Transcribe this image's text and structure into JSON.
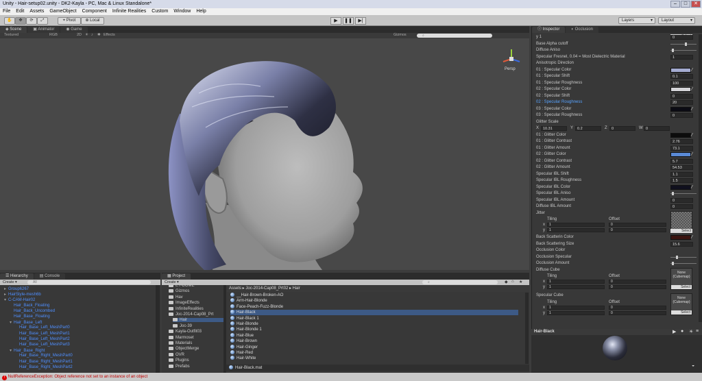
{
  "window": {
    "title": "Unity - Hair-setup02.unity - DK2-Kayla - PC, Mac & Linux Standalone*"
  },
  "menu": [
    "File",
    "Edit",
    "Assets",
    "GameObject",
    "Component",
    "Infinite Realities",
    "Custom",
    "Window",
    "Help"
  ],
  "toolbar": {
    "pivot": "Pivot",
    "local": "Local",
    "layers": "Layers",
    "layout": "Layout",
    "play_icon": "play-icon",
    "pause_icon": "pause-icon",
    "step_icon": "step-icon"
  },
  "scene": {
    "tabs": [
      "Scene",
      "Animator",
      "Game"
    ],
    "textured": "Textured",
    "rgb": "RGB",
    "mode2d": "2D",
    "effects": "Effects",
    "gizmos": "Gizmos",
    "persp": "Persp"
  },
  "inspector": {
    "tabs": [
      "Inspector",
      "Occlusion"
    ],
    "select": "Select",
    "rows": [
      {
        "label": "y 1",
        "value": "0",
        "kind": "tile"
      },
      {
        "label": "Base Alpha cutoff",
        "kind": "slider",
        "pos": 0.55
      },
      {
        "label": "Diffuse Aniso",
        "kind": "slider",
        "pos": 0.05
      },
      {
        "label": "Specular Fresnel, 0.04 = Most Dielectric Material",
        "value": "1",
        "kind": "value"
      },
      {
        "label": "Anisotropic Direction",
        "kind": "none"
      },
      {
        "label": "01 : Specular Color",
        "kind": "color",
        "color": "#a4abd0"
      },
      {
        "label": "01 : Specular Shift",
        "value": "0.1",
        "kind": "value"
      },
      {
        "label": "01 : Specular Roughness",
        "value": "100",
        "kind": "value"
      },
      {
        "label": "02 : Specular Color",
        "kind": "color",
        "color": "#d4d4d8"
      },
      {
        "label": "02 : Specular Shift",
        "value": "0",
        "kind": "value"
      },
      {
        "label": "02 : Specular Roughness",
        "value": "20",
        "kind": "value",
        "highlight": true
      },
      {
        "label": "03 : Specular Color",
        "kind": "color",
        "color": "#0b0b14"
      },
      {
        "label": "03 : Specular Roughness",
        "value": "0",
        "kind": "value"
      },
      {
        "label": "Glitter Scale",
        "kind": "none"
      },
      {
        "label": "glitter_vector",
        "kind": "vector"
      },
      {
        "label": "01 : Glitter Color",
        "kind": "color",
        "color": "#0c0c0c"
      },
      {
        "label": "01 : Glitter Contrast",
        "value": "2.76",
        "kind": "value"
      },
      {
        "label": "01 : Glitter Amount",
        "value": "73.1",
        "kind": "value"
      },
      {
        "label": "02 : Glitter Color",
        "kind": "color",
        "color": "#5a8ad6"
      },
      {
        "label": "02 : Glitter Contrast",
        "value": "5.7",
        "kind": "value"
      },
      {
        "label": "02 : Glitter Amount",
        "value": "54.53",
        "kind": "value"
      },
      {
        "label": "Specular IBL Shift",
        "value": "1.1",
        "kind": "value"
      },
      {
        "label": "Specular IBL Roughness",
        "value": "1.5",
        "kind": "value"
      },
      {
        "label": "Specular IBL Color",
        "kind": "color",
        "color": "#10101e"
      },
      {
        "label": "Specular IBL Aniso",
        "kind": "slider",
        "pos": 0.05
      },
      {
        "label": "Specular IBL Amount",
        "value": "0",
        "kind": "value"
      },
      {
        "label": "Diffuse IBL Amount",
        "value": "0",
        "kind": "value"
      }
    ],
    "vector": {
      "x_label": "X",
      "x": "10.31",
      "y_label": "Y",
      "y": "0.2",
      "z_label": "Z",
      "z": "0",
      "w_label": "W",
      "w": "0"
    },
    "jitter": {
      "label": "Jitter",
      "tiling": "Tiling",
      "offset": "Offset",
      "x_label": "x",
      "x1": "1",
      "x2": "0",
      "y_label": "y",
      "y1": "1",
      "y2": "0"
    },
    "rows2": [
      {
        "label": "Back Scatterin Color",
        "kind": "color",
        "color": "#3a1410"
      },
      {
        "label": "Back Scattering Size",
        "value": "15.6",
        "kind": "value"
      },
      {
        "label": "Occlusion Color",
        "kind": "none"
      },
      {
        "label": "Occlusion Specular",
        "kind": "slider",
        "pos": 0.2
      },
      {
        "label": "Occlusion Amount",
        "kind": "slider",
        "pos": 0.05
      }
    ],
    "diffuse_cube": {
      "label": "Diffuse Cube",
      "tiling": "Tiling",
      "offset": "Offset",
      "x_label": "x",
      "x1": "1",
      "x2": "0",
      "y_label": "y",
      "y1": "1",
      "y2": "0",
      "none": "None",
      "cubemap": "(Cubemap)"
    },
    "specular_cube": {
      "label": "Specular Cube",
      "tiling": "Tiling",
      "offset": "Offset",
      "x_label": "x",
      "x1": "1",
      "x2": "0",
      "y_label": "y",
      "y1": "1",
      "y2": "0",
      "none": "None",
      "cubemap": "(Cubemap)"
    },
    "preview_title": "Hair-Black"
  },
  "hierarchy": {
    "tabs": [
      "Hierarchy",
      "Console"
    ],
    "create": "Create",
    "search": "All",
    "items": [
      {
        "label": "Group6267",
        "indent": 0,
        "arrow": "▸"
      },
      {
        "label": "HairStyle-mesh6b",
        "indent": 0,
        "arrow": "▸"
      },
      {
        "label": "C-CAM-Hair02",
        "indent": 0,
        "arrow": "▾"
      },
      {
        "label": "Hair_Back_Floating",
        "indent": 1,
        "arrow": ""
      },
      {
        "label": "Hair_Back_Uncombed",
        "indent": 1,
        "arrow": ""
      },
      {
        "label": "Hair_Base_Floating",
        "indent": 1,
        "arrow": ""
      },
      {
        "label": "Hair_Base_Left",
        "indent": 1,
        "arrow": "▾"
      },
      {
        "label": "Hair_Base_Left_MeshPart0",
        "indent": 2,
        "arrow": ""
      },
      {
        "label": "Hair_Base_Left_MeshPart1",
        "indent": 2,
        "arrow": ""
      },
      {
        "label": "Hair_Base_Left_MeshPart2",
        "indent": 2,
        "arrow": ""
      },
      {
        "label": "Hair_Base_Left_MeshPart3",
        "indent": 2,
        "arrow": ""
      },
      {
        "label": "Hair_Base_Right",
        "indent": 1,
        "arrow": "▾"
      },
      {
        "label": "Hair_Base_Right_MeshPart0",
        "indent": 2,
        "arrow": ""
      },
      {
        "label": "Hair_Base_Right_MeshPart1",
        "indent": 2,
        "arrow": ""
      },
      {
        "label": "Hair_Base_Right_MeshPart2",
        "indent": 2,
        "arrow": ""
      }
    ]
  },
  "project": {
    "tabs": [
      "Project"
    ],
    "create": "Create",
    "folders": [
      {
        "label": "EY-DOME",
        "indent": 1
      },
      {
        "label": "Gizmos",
        "indent": 1
      },
      {
        "label": "Hav",
        "indent": 1
      },
      {
        "label": "ImageEffects",
        "indent": 1
      },
      {
        "label": "InfiniteRealities",
        "indent": 1
      },
      {
        "label": "Joc-2014-Cap08_Prt",
        "indent": 1
      },
      {
        "label": "Hair",
        "indent": 2,
        "selected": true
      },
      {
        "label": "Joc-39",
        "indent": 2
      },
      {
        "label": "Kayla-Outfit03",
        "indent": 1
      },
      {
        "label": "Marmoset",
        "indent": 1
      },
      {
        "label": "Materials",
        "indent": 1
      },
      {
        "label": "ObjectMerge",
        "indent": 1
      },
      {
        "label": "OVR",
        "indent": 1
      },
      {
        "label": "Plugins",
        "indent": 1
      },
      {
        "label": "Prefabs",
        "indent": 1
      }
    ],
    "breadcrumb": "Assets ▸ Joc-2014-Cap08_Prt02 ▸ Hair",
    "assets": [
      {
        "label": "__Hair-Brown-Broken-AO",
        "selected": false
      },
      {
        "label": "Arm-Hair-Blonde",
        "selected": false
      },
      {
        "label": "Face-Peach-Fuzz-Blonde",
        "selected": false
      },
      {
        "label": "Hair-Black",
        "selected": true
      },
      {
        "label": "Hair-Black 1",
        "selected": false
      },
      {
        "label": "Hair-Blonde",
        "selected": false
      },
      {
        "label": "Hair-Blonde 1",
        "selected": false
      },
      {
        "label": "Hair-Blue",
        "selected": false
      },
      {
        "label": "Hair-Brown",
        "selected": false
      },
      {
        "label": "Hair-Ginger",
        "selected": false
      },
      {
        "label": "Hair-Red",
        "selected": false
      },
      {
        "label": "Hair-White",
        "selected": false
      }
    ],
    "footer": "Hair-Black.mat"
  },
  "status": {
    "message": "NullReferenceException: Object reference not set to an instance of an object",
    "icon": "error-icon"
  }
}
